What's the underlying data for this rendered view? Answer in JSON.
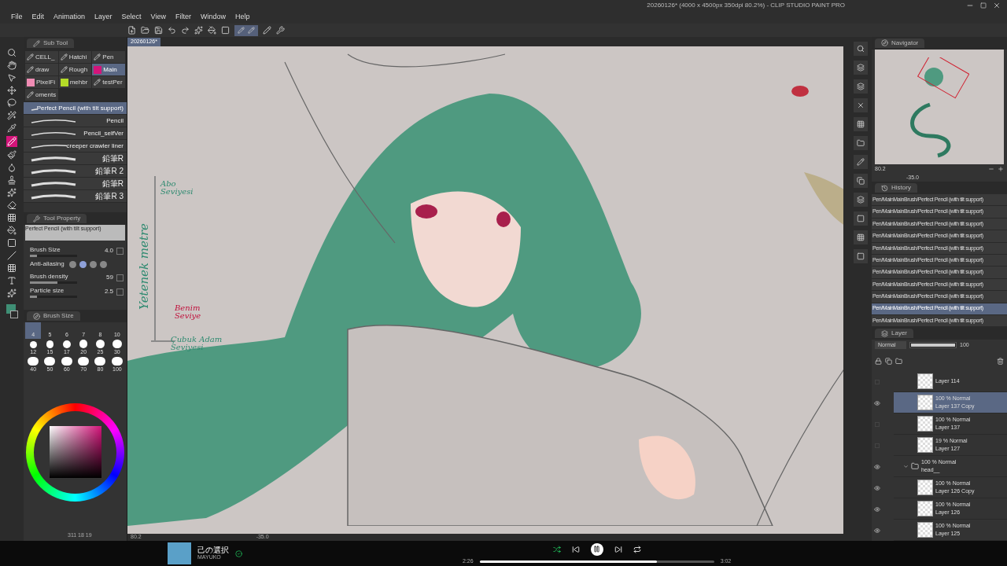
{
  "window": {
    "title": "20260126* (4000 x 4500px 350dpi 80.2%) - CLIP STUDIO PAINT PRO"
  },
  "menu": [
    "File",
    "Edit",
    "Animation",
    "Layer",
    "Select",
    "View",
    "Filter",
    "Window",
    "Help"
  ],
  "document_tab": {
    "label": "20260126*"
  },
  "toolbar": {
    "stroke_toggle": {
      "selected": true
    }
  },
  "sub_tool": {
    "title": "Sub Tool",
    "groups": [
      {
        "label": "CELL_",
        "selected": false
      },
      {
        "label": "Hatchi",
        "selected": false
      },
      {
        "label": "Pen",
        "selected": false
      },
      {
        "label": "draw",
        "selected": false
      },
      {
        "label": "Rough",
        "selected": false
      },
      {
        "label": "Main",
        "selected": true,
        "color": "#d4147a"
      },
      {
        "label": "PixelFi",
        "selected": false,
        "color": "#f08cb4"
      },
      {
        "label": "mehbr",
        "selected": false,
        "color": "#b4dc28"
      },
      {
        "label": "testPer",
        "selected": false
      },
      {
        "label": "oments",
        "selected": false
      }
    ],
    "brushes": [
      {
        "name": "Perfect Pencil (with tilt support)",
        "selected": true
      },
      {
        "name": "Pencil",
        "selected": false
      },
      {
        "name": "Pencil_selfVer",
        "selected": false
      },
      {
        "name": "creeper crawler liner",
        "selected": false
      },
      {
        "name": "鉛筆R",
        "selected": false
      },
      {
        "name": "鉛筆R 2",
        "selected": false
      },
      {
        "name": "鉛筆R",
        "selected": false
      },
      {
        "name": "鉛筆R 3",
        "selected": false
      }
    ]
  },
  "tool_property": {
    "title": "Tool Property",
    "brush": "Perfect Pencil (with tilt support)",
    "rows": [
      {
        "kind": "slider",
        "label": "Brush Size",
        "value": "4.0",
        "level": 0.15
      },
      {
        "kind": "antialias",
        "label": "Anti-aliasing",
        "options": [
          {
            "selected": false
          },
          {
            "selected": true
          },
          {
            "selected": false
          },
          {
            "selected": false
          }
        ]
      },
      {
        "kind": "slider",
        "label": "Brush density",
        "value": "59",
        "level": 0.59
      },
      {
        "kind": "slider",
        "label": "Particle size",
        "value": "2.5",
        "level": 0.15
      }
    ]
  },
  "brush_size": {
    "title": "Brush Size",
    "sizes": [
      {
        "label": "4",
        "selected": true
      },
      {
        "label": "5",
        "selected": false
      },
      {
        "label": "6",
        "selected": false
      },
      {
        "label": "7",
        "selected": false
      },
      {
        "label": "8",
        "selected": false
      },
      {
        "label": "10",
        "selected": false
      },
      {
        "label": "12",
        "selected": false
      },
      {
        "label": "15",
        "selected": false
      },
      {
        "label": "17",
        "selected": false
      },
      {
        "label": "20",
        "selected": false
      },
      {
        "label": "25",
        "selected": false
      },
      {
        "label": "30",
        "selected": false
      },
      {
        "label": "40",
        "selected": false
      },
      {
        "label": "50",
        "selected": false
      },
      {
        "label": "60",
        "selected": false
      },
      {
        "label": "70",
        "selected": false
      },
      {
        "label": "80",
        "selected": false
      },
      {
        "label": "100",
        "selected": false
      }
    ]
  },
  "left_status": "311 18 19",
  "canvas": {
    "annotations": [
      {
        "kind": "vertical",
        "text": "Yetenek metre",
        "color": "#2e8a70"
      },
      {
        "kind": "top",
        "text": "Abo Seviyesi",
        "color": "#2e8a70"
      },
      {
        "kind": "middle",
        "text": "Benim Seviye",
        "color": "#c0103c"
      },
      {
        "kind": "bottom",
        "text": "Çubuk Adam Seviyesi",
        "color": "#2e8a70"
      }
    ],
    "zoom": "80.2",
    "angle": "-35.0"
  },
  "navigator": {
    "title": "Navigator",
    "zoom": "80.2",
    "angle": "-35.0"
  },
  "history": {
    "title": "History",
    "items": [
      {
        "text": "Pen/MainMainBrush/Perfect Pencil (with tilt support)",
        "selected": false
      },
      {
        "text": "Pen/MainMainBrush/Perfect Pencil (with tilt support)",
        "selected": false
      },
      {
        "text": "Pen/MainMainBrush/Perfect Pencil (with tilt support)",
        "selected": false
      },
      {
        "text": "Pen/MainMainBrush/Perfect Pencil (with tilt support)",
        "selected": false
      },
      {
        "text": "Pen/MainMainBrush/Perfect Pencil (with tilt support)",
        "selected": false
      },
      {
        "text": "Pen/MainMainBrush/Perfect Pencil (with tilt support)",
        "selected": false
      },
      {
        "text": "Pen/MainMainBrush/Perfect Pencil (with tilt support)",
        "selected": false
      },
      {
        "text": "Pen/MainMainBrush/Perfect Pencil (with tilt support)",
        "selected": false
      },
      {
        "text": "Pen/MainMainBrush/Perfect Pencil (with tilt support)",
        "selected": false
      },
      {
        "text": "Pen/MainMainBrush/Perfect Pencil (with tilt support)",
        "selected": true
      },
      {
        "text": "Pen/MainMainBrush/Perfect Pencil (with tilt support)",
        "selected": false
      }
    ]
  },
  "layer": {
    "title": "Layer",
    "blend": "Normal",
    "opacity": "100",
    "opacity_slider": {
      "level": 1
    },
    "layers": [
      {
        "kind": "layer",
        "name": "Layer 114",
        "visible": false,
        "selected": false
      },
      {
        "kind": "layer",
        "mode": "100 % Normal",
        "name": "Layer 137 Copy",
        "visible": true,
        "selected": true
      },
      {
        "kind": "layer",
        "mode": "100 % Normal",
        "name": "Layer 137",
        "visible": false,
        "selected": false
      },
      {
        "kind": "layer",
        "mode": "19 % Normal",
        "name": "Layer 127",
        "visible": false,
        "selected": false
      },
      {
        "kind": "folder",
        "mode": "100 % Normal",
        "name": "head__",
        "visible": true,
        "selected": false,
        "expanded": true
      },
      {
        "kind": "layer",
        "mode": "100 % Normal",
        "name": "Layer 126 Copy",
        "visible": true,
        "selected": false
      },
      {
        "kind": "layer",
        "mode": "100 % Normal",
        "name": "Layer 126",
        "visible": true,
        "selected": false
      },
      {
        "kind": "layer",
        "mode": "100 % Normal",
        "name": "Layer 125",
        "visible": true,
        "selected": false
      }
    ]
  },
  "player": {
    "title": "己の選択",
    "artist": "MAYUKO",
    "elapsed": "2:26",
    "duration": "3:02",
    "level": 0.755
  }
}
